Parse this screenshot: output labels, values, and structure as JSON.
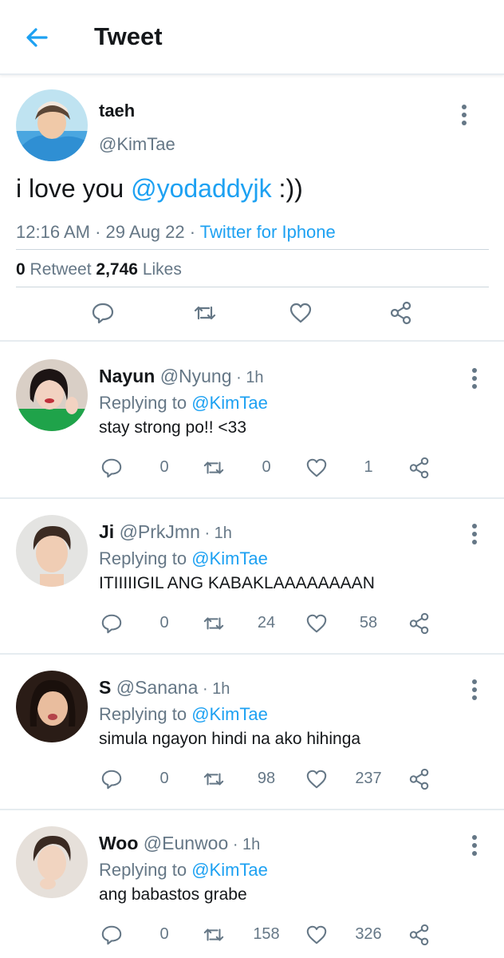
{
  "header": {
    "title": "Tweet"
  },
  "tweet": {
    "name": "taeh",
    "handle": "@KimTae",
    "text_prefix": "i love you ",
    "mention": "@yodaddyjk",
    "text_suffix": " :))",
    "time": "12:16 AM",
    "date": "29 Aug 22",
    "source": "Twitter for Iphone",
    "retweets_count": "0",
    "retweets_label": "Retweet",
    "likes_count": "2,746",
    "likes_label": "Likes"
  },
  "replying_label": "Replying to",
  "replies": [
    {
      "name": "Nayun",
      "handle": "@Nyung",
      "time": "1h",
      "reply_to": "@KimTae",
      "text": "stay strong po!! <33",
      "replies": "0",
      "retweets": "0",
      "likes": "1"
    },
    {
      "name": "Ji",
      "handle": "@PrkJmn",
      "time": "1h",
      "reply_to": "@KimTae",
      "text": "ITIIIIIGIL ANG KABAKLAAAAAAAAN",
      "replies": "0",
      "retweets": "24",
      "likes": "58"
    },
    {
      "name": "S",
      "handle": "@Sanana",
      "time": "1h",
      "reply_to": "@KimTae",
      "text": "simula ngayon hindi na ako hihinga",
      "replies": "0",
      "retweets": "98",
      "likes": "237"
    },
    {
      "name": "Woo",
      "handle": "@Eunwoo",
      "time": "1h",
      "reply_to": "@KimTae",
      "text": "ang babastos grabe",
      "replies": "0",
      "retweets": "158",
      "likes": "326"
    }
  ],
  "colors": {
    "accent": "#1da1f2",
    "muted": "#657786",
    "text": "#14171a"
  }
}
